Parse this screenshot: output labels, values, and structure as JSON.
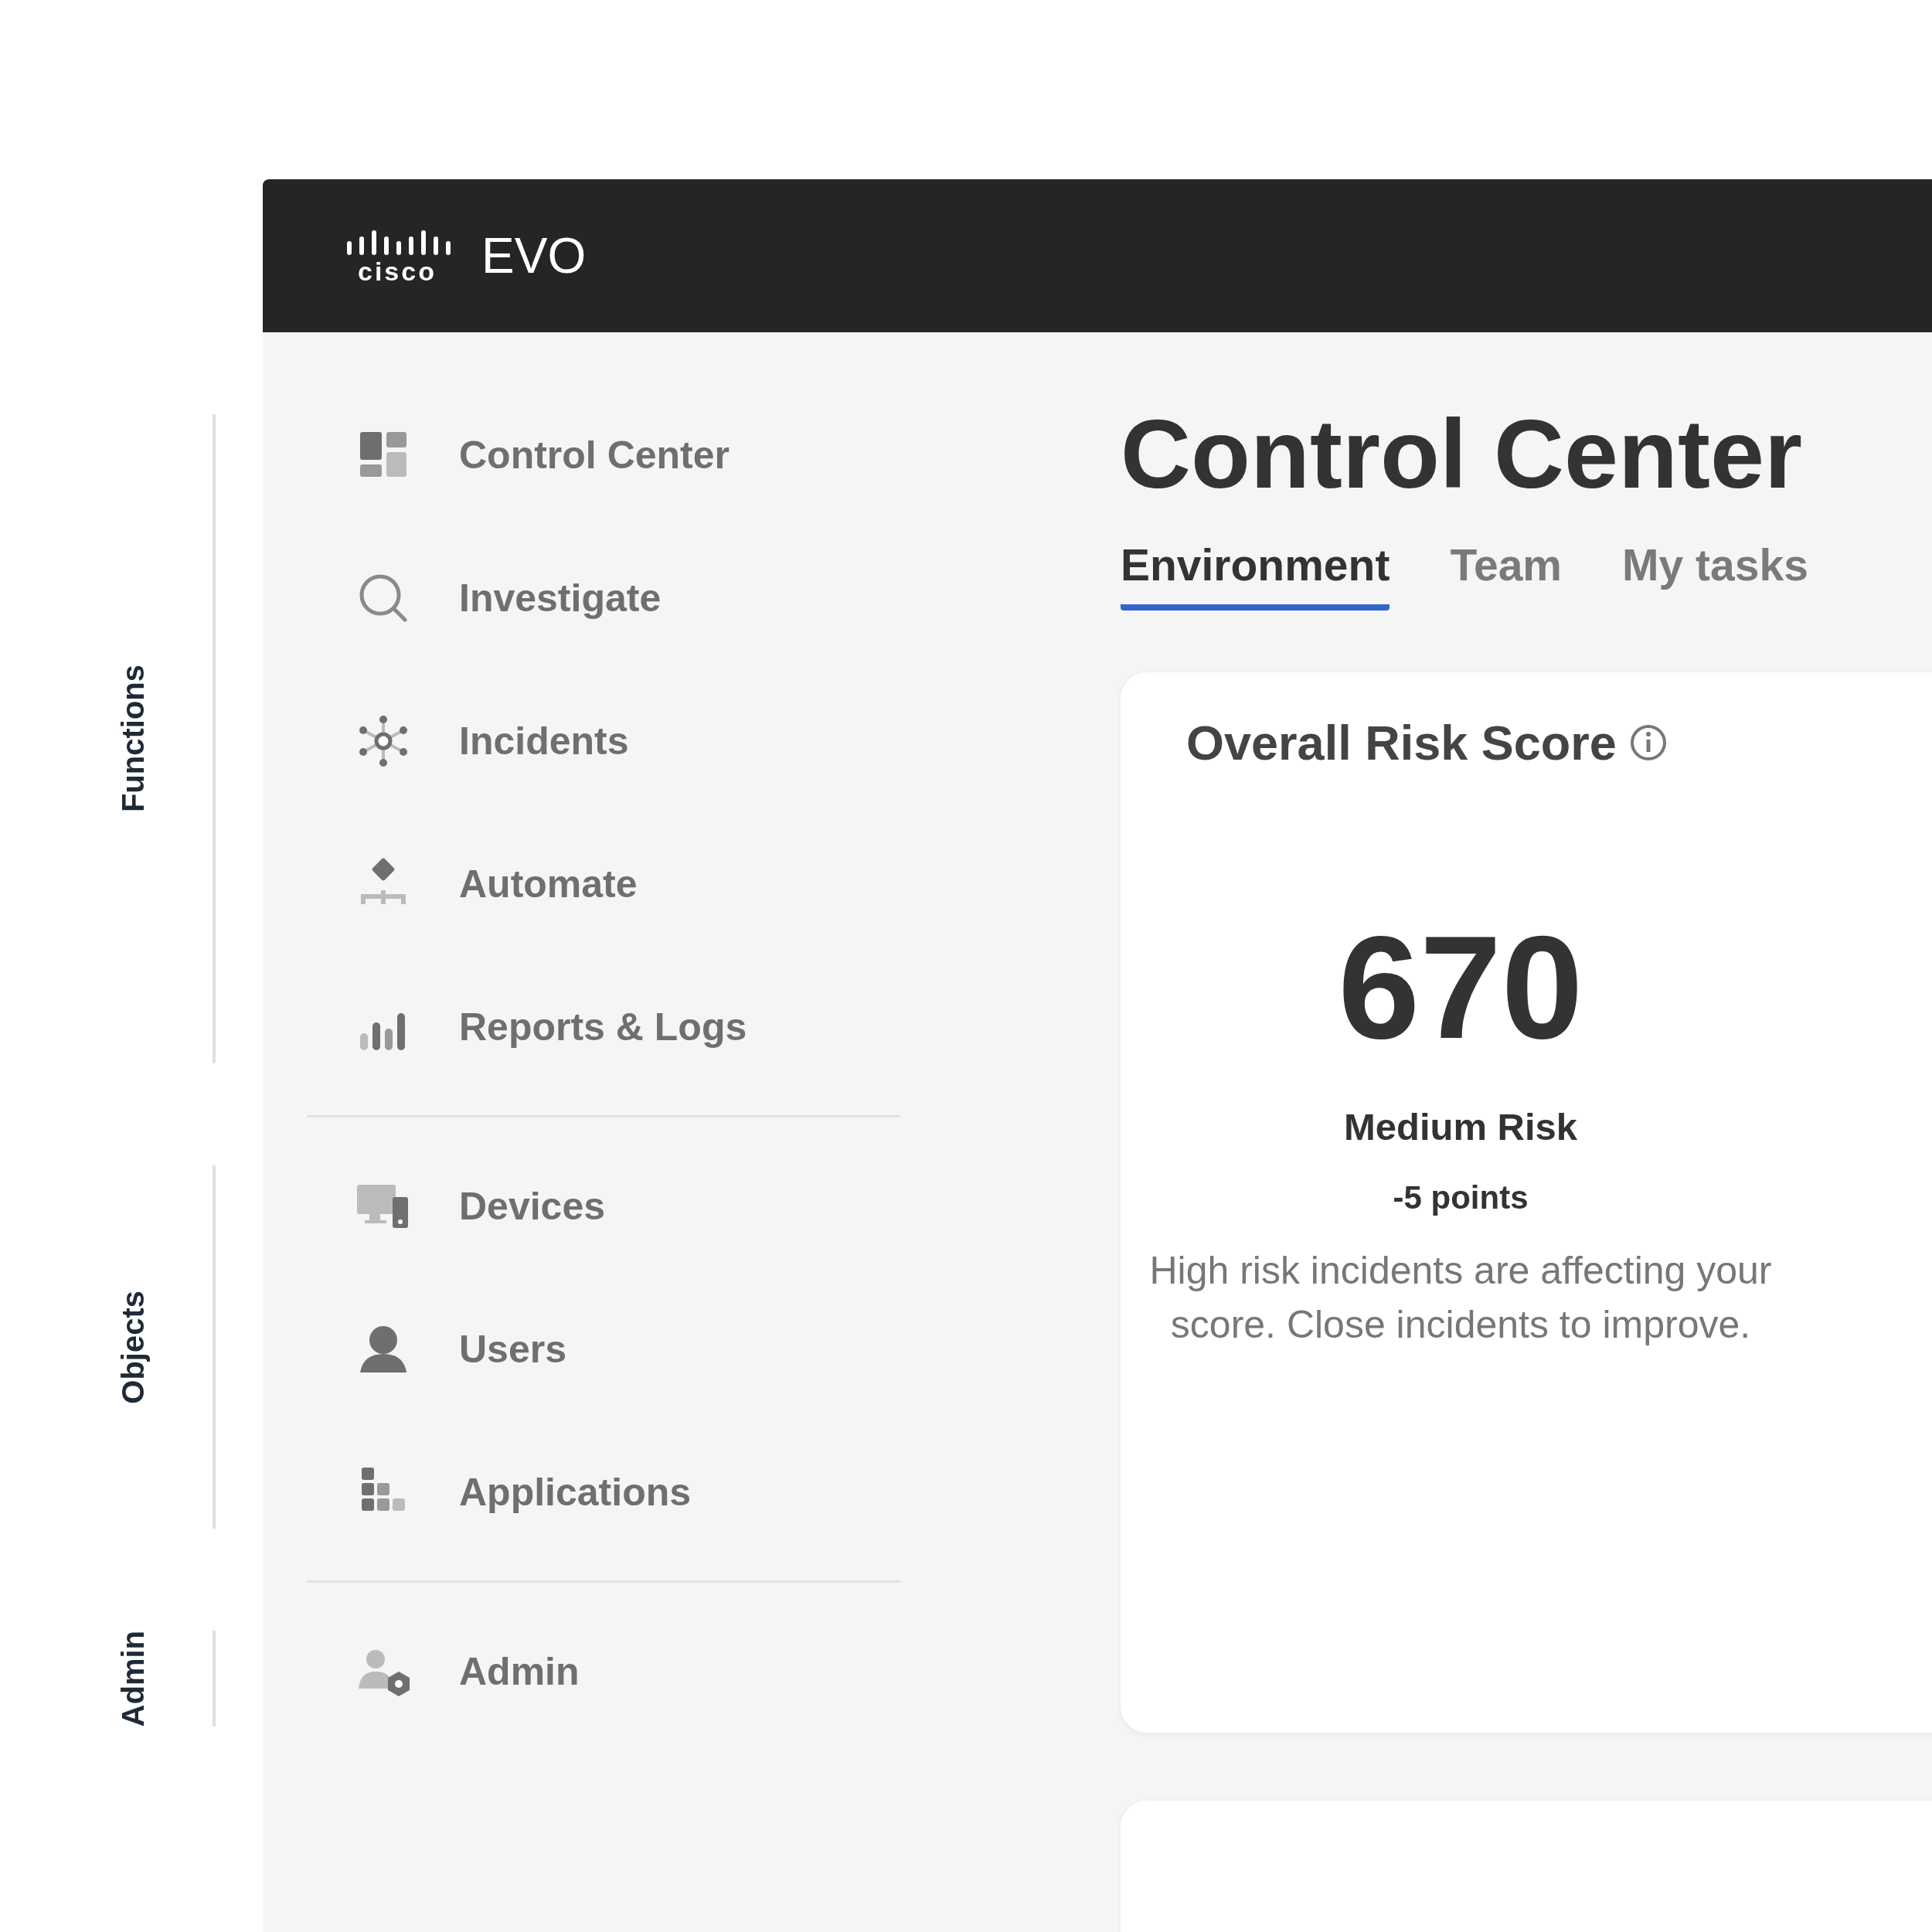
{
  "header": {
    "logo_text": "cisco",
    "product": "EVO"
  },
  "sidebar": {
    "sections": [
      {
        "label": "Functions",
        "items": [
          {
            "label": "Control Center"
          },
          {
            "label": "Investigate"
          },
          {
            "label": "Incidents"
          },
          {
            "label": "Automate"
          },
          {
            "label": "Reports & Logs"
          }
        ]
      },
      {
        "label": "Objects",
        "items": [
          {
            "label": "Devices"
          },
          {
            "label": "Users"
          },
          {
            "label": "Applications"
          }
        ]
      },
      {
        "label": "Admin",
        "items": [
          {
            "label": "Admin"
          }
        ]
      }
    ]
  },
  "main": {
    "title": "Control Center",
    "tabs": [
      {
        "label": "Environment",
        "selected": true
      },
      {
        "label": "Team",
        "selected": false
      },
      {
        "label": "My tasks",
        "selected": false
      }
    ],
    "risk_card": {
      "title": "Overall Risk Score",
      "score": "670",
      "level": "Medium Risk",
      "change": "-5 points",
      "description": "High risk incidents are affecting your score. Close incidents to improve."
    }
  }
}
